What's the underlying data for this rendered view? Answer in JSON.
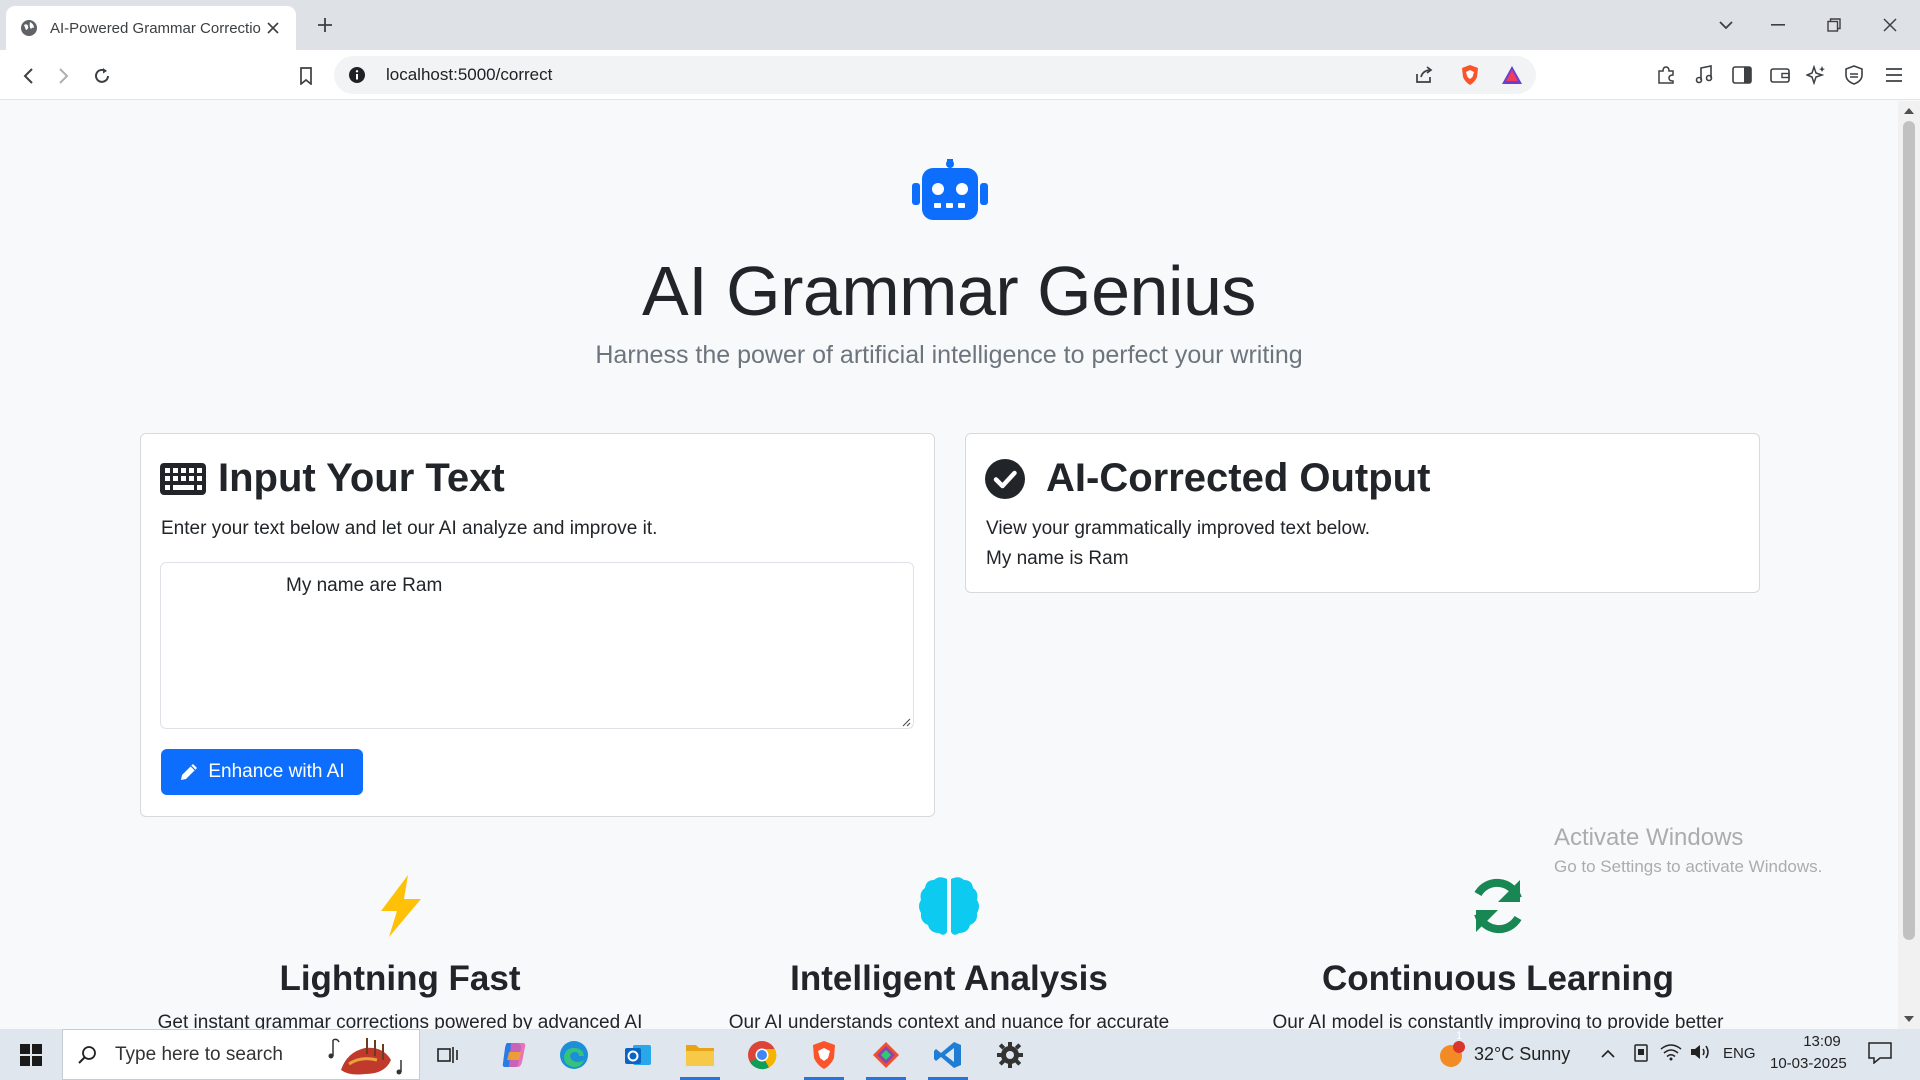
{
  "browser": {
    "tab_title": "AI-Powered Grammar Correctio",
    "url": "localhost:5000/correct"
  },
  "hero": {
    "icon": "robot-icon",
    "title": "AI Grammar Genius",
    "subtitle": "Harness the power of artificial intelligence to perfect your writing"
  },
  "input_card": {
    "icon": "keyboard-icon",
    "title": "Input Your Text",
    "description": "Enter your text below and let our AI analyze and improve it.",
    "textarea_value": "My name are Ram",
    "button_icon": "pencil-icon",
    "button_label": "Enhance with AI",
    "accent_color": "#0d6efd"
  },
  "output_card": {
    "icon": "check-circle-icon",
    "title": "AI-Corrected Output",
    "description": "View your grammatically improved text below.",
    "result": "My name is Ram"
  },
  "features": [
    {
      "icon": "lightning-icon",
      "color": "#ffc107",
      "title": "Lightning Fast",
      "description": "Get instant grammar corrections powered by advanced AI"
    },
    {
      "icon": "brain-icon",
      "color": "#0dcaf0",
      "title": "Intelligent Analysis",
      "description": "Our AI understands context and nuance for accurate"
    },
    {
      "icon": "sync-icon",
      "color": "#198754",
      "title": "Continuous Learning",
      "description": "Our AI model is constantly improving to provide better"
    }
  ],
  "watermark": {
    "line1": "Activate Windows",
    "line2": "Go to Settings to activate Windows."
  },
  "taskbar": {
    "search_placeholder": "Type here to search",
    "weather": "32°C  Sunny",
    "language": "ENG",
    "time": "13:09",
    "date": "10-03-2025",
    "notification_badge": "1"
  }
}
